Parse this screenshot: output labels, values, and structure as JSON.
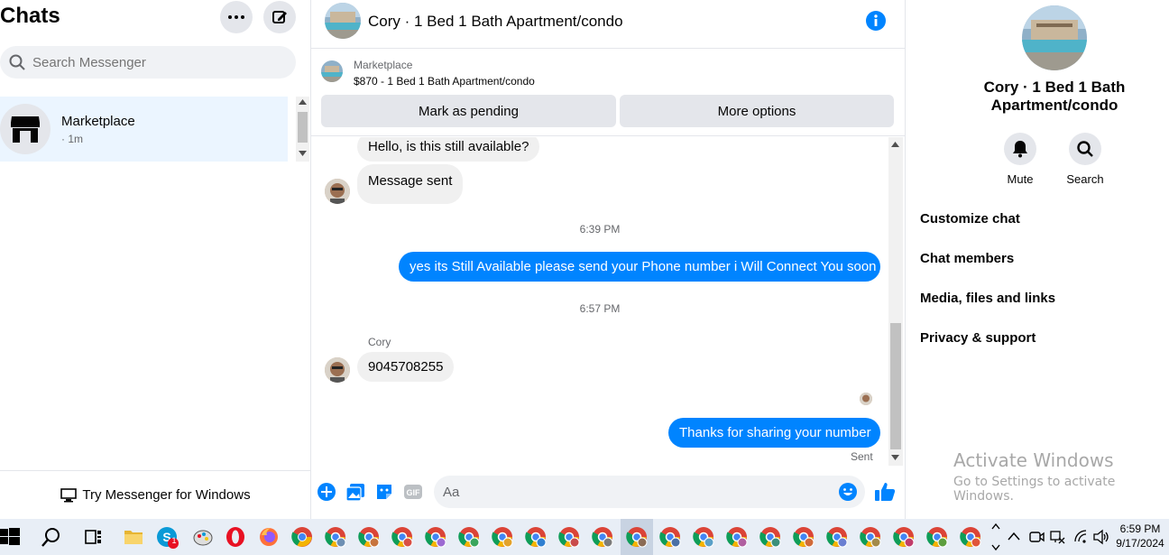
{
  "left": {
    "title": "Chats",
    "search_placeholder": "Search Messenger",
    "conversations": [
      {
        "name": "Marketplace",
        "time": "· 1m"
      }
    ],
    "try_messenger_label": "Try Messenger for Windows"
  },
  "chat": {
    "header_title": "Cory · 1 Bed 1 Bath Apartment/condo",
    "marketplace_label": "Marketplace",
    "listing_price_title": "$870 - 1 Bed 1 Bath Apartment/condo",
    "mark_pending_label": "Mark as pending",
    "more_options_label": "More options",
    "messages": {
      "m1": "Hello, is this still available?",
      "m2": "Message sent",
      "ts1": "6:39 PM",
      "m3": "yes its Still Available please send your Phone number i Will Connect You soon",
      "ts2": "6:57 PM",
      "sender": "Cory",
      "m4": "9045708255",
      "m5": "Thanks for sharing your number",
      "status": "Sent"
    },
    "composer_placeholder": "Aa"
  },
  "right": {
    "title": "Cory · 1 Bed 1 Bath Apartment/condo",
    "mute_label": "Mute",
    "search_label": "Search",
    "menu": [
      "Customize chat",
      "Chat members",
      "Media, files and links",
      "Privacy & support"
    ],
    "activate_title": "Activate Windows",
    "activate_sub": "Go to Settings to activate Windows."
  },
  "taskbar": {
    "time": "6:59 PM",
    "date": "9/17/2024",
    "notification_count": "1"
  },
  "colors": {
    "accent": "#0084ff",
    "selected_bg": "#ebf5ff",
    "bubble_in": "#f0f0f0"
  }
}
